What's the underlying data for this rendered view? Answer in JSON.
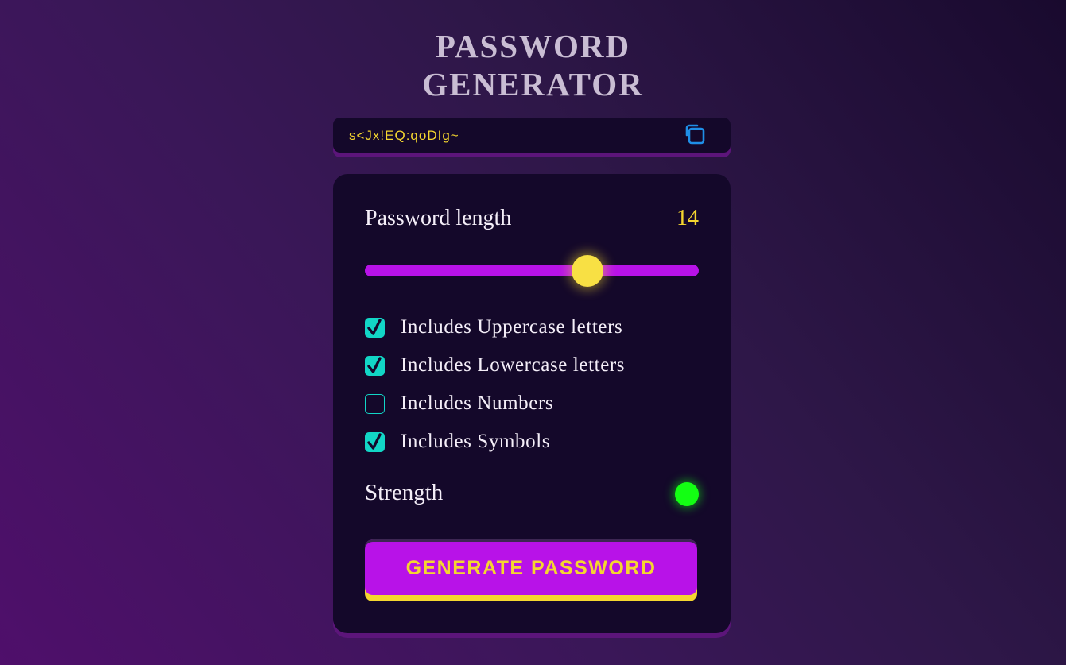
{
  "title": {
    "line1": "PASSWORD",
    "line2": "GENERATOR"
  },
  "password_display": {
    "value": "s<Jx!EQ:qoDIg~",
    "copy_icon": "copy-icon"
  },
  "length": {
    "label": "Password length",
    "value": "14",
    "slider_fraction": 0.667
  },
  "options": [
    {
      "label": "Includes Uppercase letters",
      "checked": true
    },
    {
      "label": "Includes Lowercase letters",
      "checked": true
    },
    {
      "label": "Includes Numbers",
      "checked": false
    },
    {
      "label": "Includes Symbols",
      "checked": true
    }
  ],
  "strength": {
    "label": "Strength",
    "indicator_color": "#13ff13"
  },
  "generate_button": {
    "label": "GENERATE PASSWORD"
  },
  "colors": {
    "accent_purple": "#b812e8",
    "accent_yellow": "#f5d62f",
    "checkbox_teal": "#12d6c6",
    "card_bg": "#14082a"
  }
}
